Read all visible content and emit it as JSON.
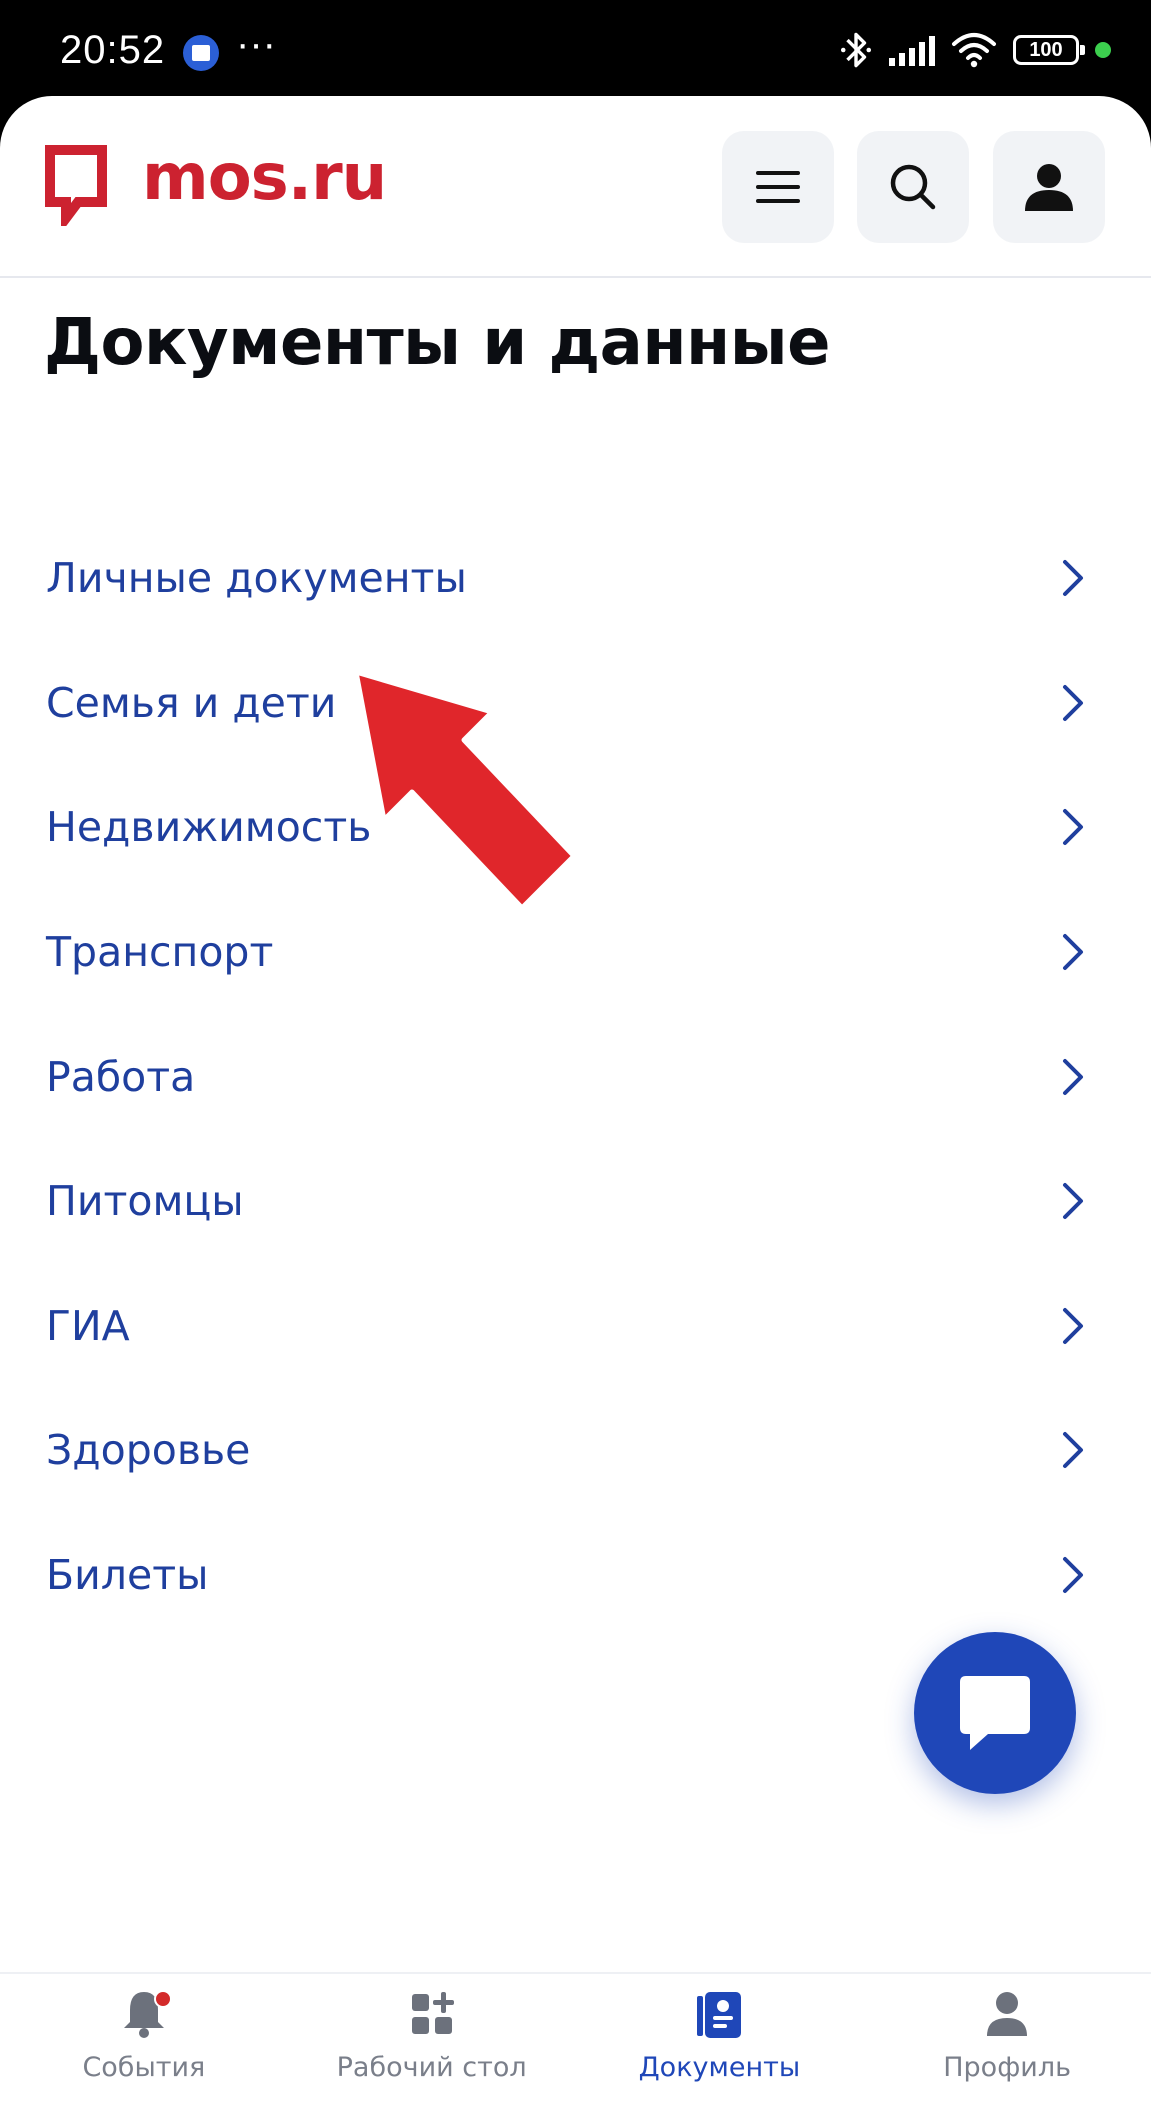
{
  "status_bar": {
    "time": "20:52",
    "more_glyph": "···",
    "battery_level": "100",
    "icons": [
      "app-notification-icon",
      "bluetooth-icon",
      "signal-icon",
      "wifi-icon",
      "battery-icon",
      "privacy-dot"
    ]
  },
  "header": {
    "logo_text": "mos.ru",
    "brand_color": "#cc2230",
    "buttons": [
      "menu-icon",
      "search-icon",
      "user-icon"
    ]
  },
  "page": {
    "title": "Документы и данные",
    "link_color": "#1f3f9e"
  },
  "categories": [
    {
      "label": "Личные документы"
    },
    {
      "label": "Семья и дети"
    },
    {
      "label": "Недвижимость"
    },
    {
      "label": "Транспорт"
    },
    {
      "label": "Работа"
    },
    {
      "label": "Питомцы"
    },
    {
      "label": "ГИА"
    },
    {
      "label": "Здоровье"
    },
    {
      "label": "Билеты"
    }
  ],
  "annotation": {
    "type": "red-arrow",
    "points_to": "Семья и дети",
    "color": "#e0262b"
  },
  "fab": {
    "icon": "chat-icon",
    "color": "#1f47b8"
  },
  "tabbar": {
    "active_color": "#1f47b8",
    "tabs": [
      {
        "label": "События",
        "icon": "bell-icon",
        "has_badge": true
      },
      {
        "label": "Рабочий стол",
        "icon": "dashboard-icon",
        "has_badge": false
      },
      {
        "label": "Документы",
        "icon": "documents-icon",
        "active": true
      },
      {
        "label": "Профиль",
        "icon": "profile-icon",
        "has_badge": false
      }
    ]
  }
}
